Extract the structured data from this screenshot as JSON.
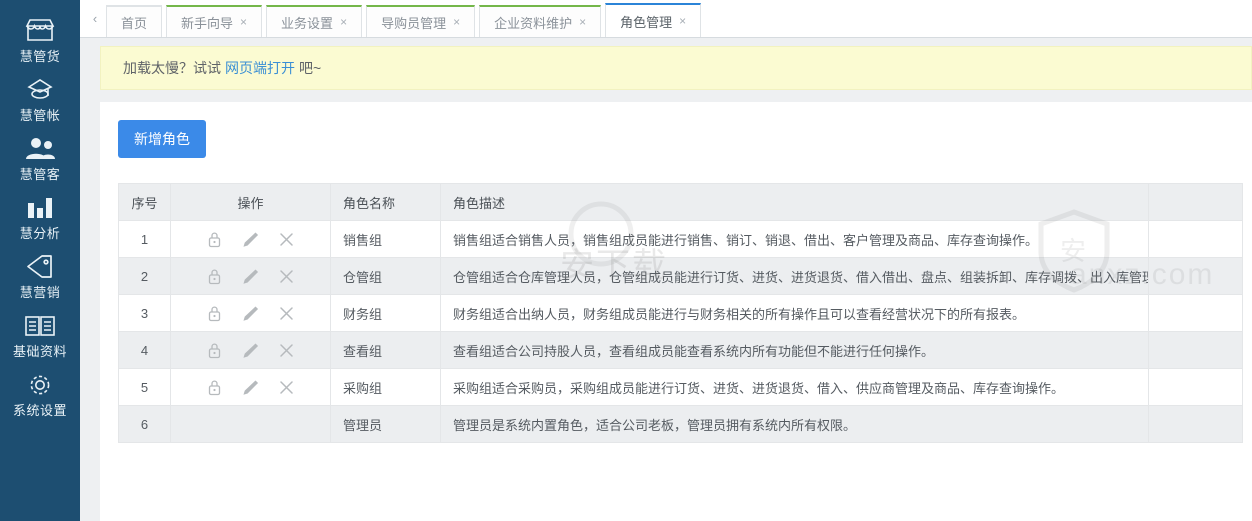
{
  "sidebar": {
    "items": [
      {
        "label": "慧管货",
        "icon": "shop-icon"
      },
      {
        "label": "慧管帐",
        "icon": "account-book-icon"
      },
      {
        "label": "慧管客",
        "icon": "customers-icon"
      },
      {
        "label": "慧分析",
        "icon": "bar-chart-icon"
      },
      {
        "label": "慧营销",
        "icon": "tag-icon"
      },
      {
        "label": "基础资料",
        "icon": "book-icon"
      },
      {
        "label": "系统设置",
        "icon": "gear-icon"
      }
    ],
    "bg_color": "#1d4e71"
  },
  "tabbar": {
    "scroll_left_glyph": "‹",
    "close_glyph": "×",
    "tabs": [
      {
        "label": "首页",
        "closable": false,
        "active": false
      },
      {
        "label": "新手向导",
        "closable": true,
        "active": false
      },
      {
        "label": "业务设置",
        "closable": true,
        "active": false
      },
      {
        "label": "导购员管理",
        "closable": true,
        "active": false
      },
      {
        "label": "企业资料维护",
        "closable": true,
        "active": false
      },
      {
        "label": "角色管理",
        "closable": true,
        "active": true
      }
    ],
    "active_border_color": "#2b84d8",
    "inactive_border_color": "#74b74a"
  },
  "notice": {
    "prefix": "加载太慢？试试",
    "link": "网页端打开",
    "suffix": "吧~",
    "bg_color": "#fbfbd2",
    "link_color": "#3b8fd4"
  },
  "toolbar": {
    "add_role_label": "新增角色",
    "primary_color": "#3b8ae8"
  },
  "table": {
    "columns": [
      "序号",
      "操作",
      "角色名称",
      "角色描述",
      ""
    ],
    "op_icons": [
      "lock-icon",
      "edit-icon",
      "delete-icon"
    ],
    "rows": [
      {
        "index": "1",
        "name": "销售组",
        "desc": "销售组适合销售人员，销售组成员能进行销售、销订、销退、借出、客户管理及商品、库存查询操作。",
        "has_ops": true,
        "extra": ""
      },
      {
        "index": "2",
        "name": "仓管组",
        "desc": "仓管组适合仓库管理人员，仓管组成员能进行订货、进货、进货退货、借入借出、盘点、组装拆卸、库存调拨、出入库管理及查询操作。",
        "has_ops": true,
        "extra": ""
      },
      {
        "index": "3",
        "name": "财务组",
        "desc": "财务组适合出纳人员，财务组成员能进行与财务相关的所有操作且可以查看经营状况下的所有报表。",
        "has_ops": true,
        "extra": ""
      },
      {
        "index": "4",
        "name": "查看组",
        "desc": "查看组适合公司持股人员，查看组成员能查看系统内所有功能但不能进行任何操作。",
        "has_ops": true,
        "extra": ""
      },
      {
        "index": "5",
        "name": "采购组",
        "desc": "采购组适合采购员，采购组成员能进行订货、进货、进货退货、借入、供应商管理及商品、库存查询操作。",
        "has_ops": true,
        "extra": ""
      },
      {
        "index": "6",
        "name": "管理员",
        "desc": "管理员是系统内置角色，适合公司老板，管理员拥有系统内所有权限。",
        "has_ops": false,
        "extra": ""
      }
    ]
  },
  "watermark": {
    "text1": "安下载",
    "text2": "anxz.com"
  }
}
